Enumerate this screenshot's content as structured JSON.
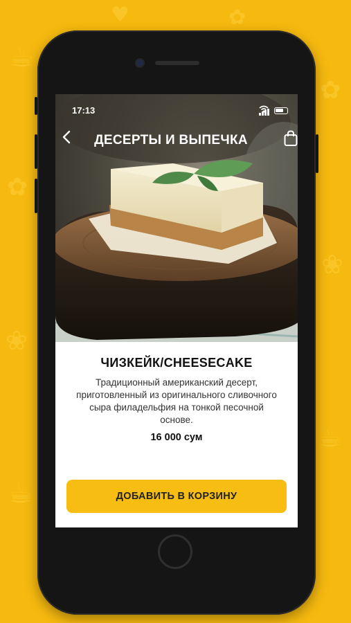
{
  "status_bar": {
    "time": "17:13"
  },
  "header": {
    "title": "ДЕСЕРТЫ И ВЫПЕЧКА"
  },
  "icons": {
    "back": "chevron-left-icon",
    "bag": "shopping-bag-icon"
  },
  "product": {
    "name": "ЧИЗКЕЙК/CHEESECAKE",
    "description": "Традиционный американский десерт, приготовленный из оригинального сливочного сыра филадельфия на тонкой песочной основе.",
    "price": "16 000 сум"
  },
  "actions": {
    "add_to_cart_label": "ДОБАВИТЬ В КОРЗИНУ"
  },
  "colors": {
    "accent": "#f7bd13",
    "background": "#f6b90f"
  }
}
